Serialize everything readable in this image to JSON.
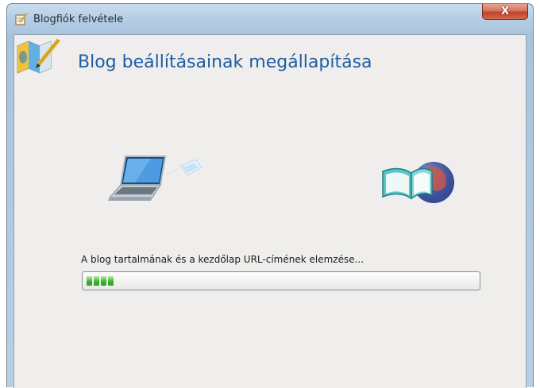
{
  "window": {
    "title": "Blogfiók felvétele",
    "close_symbol": "X"
  },
  "page": {
    "title": "Blog beállításainak megállapítása"
  },
  "status": {
    "text": "A blog tartalmának és a kezdőlap URL-címének elemzése..."
  },
  "progress": {
    "fraction": 0.08
  },
  "icons": {
    "title_icon": "notepad-pencil-icon",
    "header_icon": "map-pencil-icon",
    "left_illustration": "laptop-icon",
    "right_illustration": "globe-book-icon"
  },
  "colors": {
    "title_accent": "#1e5da6",
    "progress_green": "#3fb52b",
    "close_red": "#c0412a"
  }
}
